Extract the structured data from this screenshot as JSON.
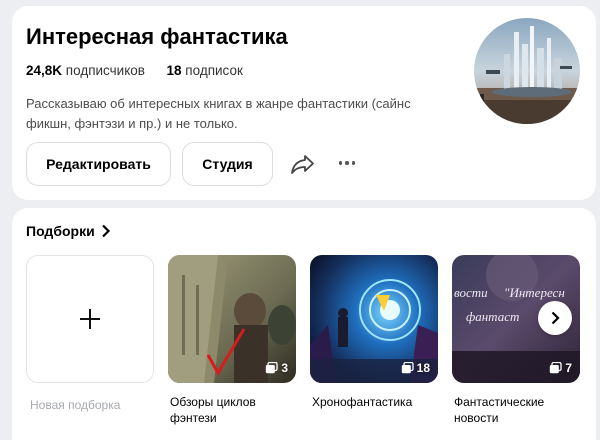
{
  "profile": {
    "title": "Интересная фантастика",
    "subscribers_count": "24,8K",
    "subscribers_label": "подписчиков",
    "subscriptions_count": "18",
    "subscriptions_label": "подписок",
    "description": "Рассказываю об интересных книгах в жанре фантастики (сайнс фикшн, фэнтэзи и пр.) и не только.",
    "edit_label": "Редактировать",
    "studio_label": "Студия",
    "share_icon": "share-arrow-icon",
    "more_icon": "more-dots-icon"
  },
  "collections": {
    "header": "Подборки",
    "new_label": "Новая подборка",
    "items": [
      {
        "caption": "Обзоры циклов фэнтези",
        "count": "3"
      },
      {
        "caption": "Хронофантастика",
        "count": "18"
      },
      {
        "caption": "Фантастические новости",
        "count": "7",
        "cover_text_1": "вости",
        "cover_text_2": "\"Интересн",
        "cover_text_3": "фантаст"
      }
    ]
  },
  "colors": {
    "page_bg": "#eceef2",
    "card_bg": "#ffffff",
    "muted_text": "#a7a9b0"
  }
}
